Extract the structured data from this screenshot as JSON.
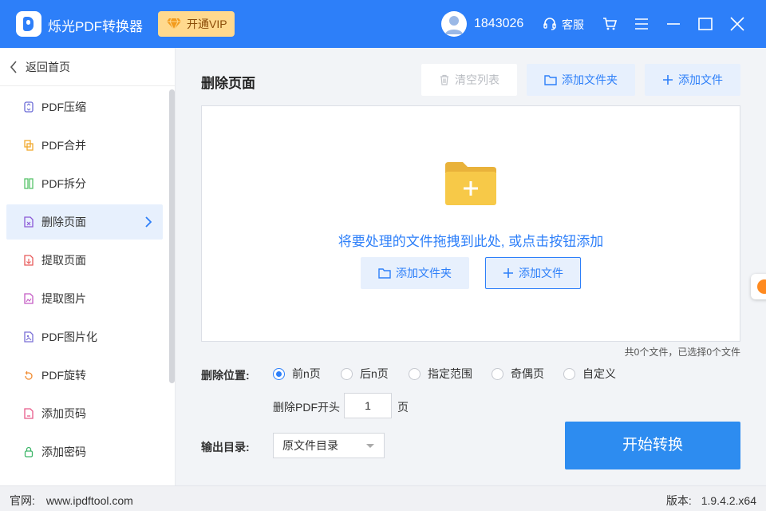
{
  "app": {
    "title": "烁光PDF转换器",
    "vip_label": "开通VIP"
  },
  "header": {
    "user_id": "1843026",
    "service_label": "客服"
  },
  "sidebar": {
    "back_label": "返回首页",
    "items": [
      {
        "label": "PDF压缩",
        "icon": "compress-icon",
        "color": "#6b6bd6"
      },
      {
        "label": "PDF合并",
        "icon": "merge-icon",
        "color": "#f0a92e"
      },
      {
        "label": "PDF拆分",
        "icon": "split-icon",
        "color": "#58c46a"
      },
      {
        "label": "删除页面",
        "icon": "delete-page-icon",
        "color": "#8a57d6",
        "active": true
      },
      {
        "label": "提取页面",
        "icon": "extract-page-icon",
        "color": "#e85a5a"
      },
      {
        "label": "提取图片",
        "icon": "extract-image-icon",
        "color": "#c45ac4"
      },
      {
        "label": "PDF图片化",
        "icon": "pdf-to-image-icon",
        "color": "#7a6fd6"
      },
      {
        "label": "PDF旋转",
        "icon": "rotate-icon",
        "color": "#f08a2e"
      },
      {
        "label": "添加页码",
        "icon": "page-number-icon",
        "color": "#e85a8a"
      },
      {
        "label": "添加密码",
        "icon": "lock-icon",
        "color": "#3fb66a"
      }
    ]
  },
  "main": {
    "title": "删除页面",
    "clear_list": "清空列表",
    "add_folder": "添加文件夹",
    "add_file": "添加文件",
    "drop_hint": "将要处理的文件拖拽到此处, 或点击按钮添加",
    "summary": "共0个文件，已选择0个文件"
  },
  "options": {
    "position_label": "删除位置:",
    "radios": [
      {
        "label": "前n页",
        "selected": true
      },
      {
        "label": "后n页",
        "selected": false
      },
      {
        "label": "指定范围",
        "selected": false
      },
      {
        "label": "奇偶页",
        "selected": false
      },
      {
        "label": "自定义",
        "selected": false
      }
    ],
    "pages_prefix": "删除PDF开头",
    "pages_value": "1",
    "pages_suffix": "页",
    "output_label": "输出目录:",
    "output_value": "原文件目录",
    "start_button": "开始转换"
  },
  "footer": {
    "site_label": "官网:",
    "site_url": "www.ipdftool.com",
    "version_label": "版本:",
    "version_value": "1.9.4.2.x64"
  },
  "colors": {
    "primary": "#2d7ff9",
    "vip": "#ffd98e",
    "folder": "#f7c948"
  }
}
